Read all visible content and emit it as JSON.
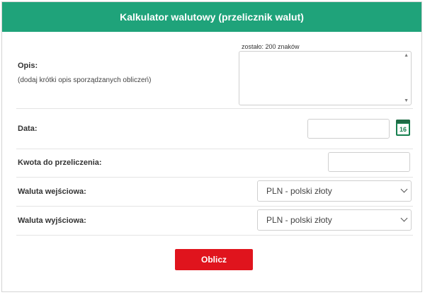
{
  "header": {
    "title": "Kalkulator walutowy (przelicznik walut)"
  },
  "description": {
    "label": "Opis:",
    "hint": "(dodaj krótki opis sporządzanych obliczeń)",
    "counter": "zostało: 200 znaków",
    "value": ""
  },
  "date": {
    "label": "Data:",
    "value": "",
    "calendar_day": "16"
  },
  "amount": {
    "label": "Kwota do przeliczenia:",
    "value": ""
  },
  "from_currency": {
    "label": "Waluta wejściowa:",
    "selected": "PLN - polski złoty"
  },
  "to_currency": {
    "label": "Waluta wyjściowa:",
    "selected": "PLN - polski złoty"
  },
  "actions": {
    "calculate_label": "Oblicz"
  },
  "colors": {
    "header": "#1fa37a",
    "button": "#e0141d",
    "calendar": "#16804f"
  }
}
